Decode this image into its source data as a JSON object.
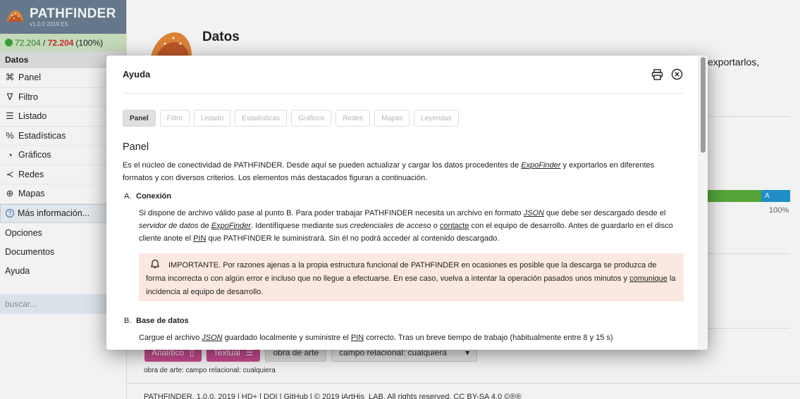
{
  "app": {
    "name": "PATHFINDER",
    "version": "v1.0.0 2019 ES",
    "count_current": "72.204",
    "count_sep": " / ",
    "count_total": "72.204",
    "count_pct": "(100%)"
  },
  "sidebar": {
    "section_label": "Datos",
    "items": [
      {
        "label": "Panel",
        "icon": "⌘"
      },
      {
        "label": "Filtro",
        "icon": "∇"
      },
      {
        "label": "Listado",
        "icon": "☰"
      },
      {
        "label": "Estadísticas",
        "icon": "%"
      },
      {
        "label": "Gráficos",
        "icon": "◔"
      },
      {
        "label": "Redes",
        "icon": "≺"
      },
      {
        "label": "Mapas",
        "icon": "⊕"
      }
    ],
    "more_label": "Más información...",
    "more_icon": "?",
    "plain_items": [
      "Opciones",
      "Documentos",
      "Ayuda"
    ],
    "search_placeholder": "buscar..."
  },
  "main": {
    "title": "Datos",
    "right_text": "exportarlos,",
    "bar_label": "A",
    "bar_pct": "100%",
    "bar_fill": 1.0,
    "btn_analitico": "Analítico",
    "btn_textual": "Textual",
    "btn_obra": "obra de arte",
    "select_value": "campo relacional: cualquiera",
    "below_text": "obra de arte: campo relacional: cualquiera",
    "footer": "PATHFINDER, 1.0.0, 2019 | HD+ | DOI | GitHub | © 2019 iArtHis_LAB. All rights reserved. CC BY-SA 4.0 ©®®"
  },
  "modal": {
    "title": "Ayuda",
    "tabs": [
      "Panel",
      "Filtro",
      "Listado",
      "Estadísticas",
      "Gráficos",
      "Redes",
      "Mapas",
      "Leyendas"
    ],
    "active_tab": "Panel",
    "section_title": "Panel",
    "intro_1": "Es el núcleo de conectividad de PATHFINDER. Desde aquí se pueden actualizar y cargar los datos procedentes de ",
    "intro_link": "ExpoFinder",
    "intro_2": " y exportarlos en diferentes formatos y con diversos criterios. Los elementos más destacados figuran a continuación.",
    "a_letter": "A.",
    "a_title": "Conexión",
    "a_1": "Si dispone de archivo válido pase al punto B. Para poder trabajar PATHFINDER necesita un archivo en formato ",
    "a_json": "JSON",
    "a_2": " que debe ser descargado desde el ",
    "a_srv": "servidor de datos",
    "a_3": " de ",
    "a_expo": "ExpoFinder",
    "a_4": ". Identifíquese mediante sus ",
    "a_cred": "credenciales de acceso",
    "a_5": " o ",
    "a_contact": "contacte",
    "a_6": " con el equipo de desarrollo. Antes de guardarlo en el disco cliente anote el ",
    "a_pin": "PIN",
    "a_7": " que PATHFINDER le suministrará. Sin él no podrá acceder al contenido descargado.",
    "warn_1": "IMPORTANTE. Por razones ajenas a la propia estructura funcional de PATHFINDER en ocasiones es posible que la descarga se produzca de forma incorrecta o con algún error e incluso que no llegue a efectuarse. En ese caso, vuelva a intentar la operación pasados unos minutos y ",
    "warn_link": "comunique",
    "warn_2": " la incidencia al equipo de desarrollo.",
    "b_letter": "B.",
    "b_title": "Base de datos",
    "b_1": "Cargue el archivo ",
    "b_json": "JSON",
    "b_2": " guardado localmente y suministre el ",
    "b_pin": "PIN",
    "b_3": " correcto. Tras un breve tiempo de trabajo (habitualmente entre 8 y 15 s)"
  },
  "colors": {
    "brand": "#6a7e93",
    "ok": "#3aa63a",
    "alert": "#d12b2b",
    "accent": "#d14e97",
    "warn_bg": "#fbe8e0"
  }
}
